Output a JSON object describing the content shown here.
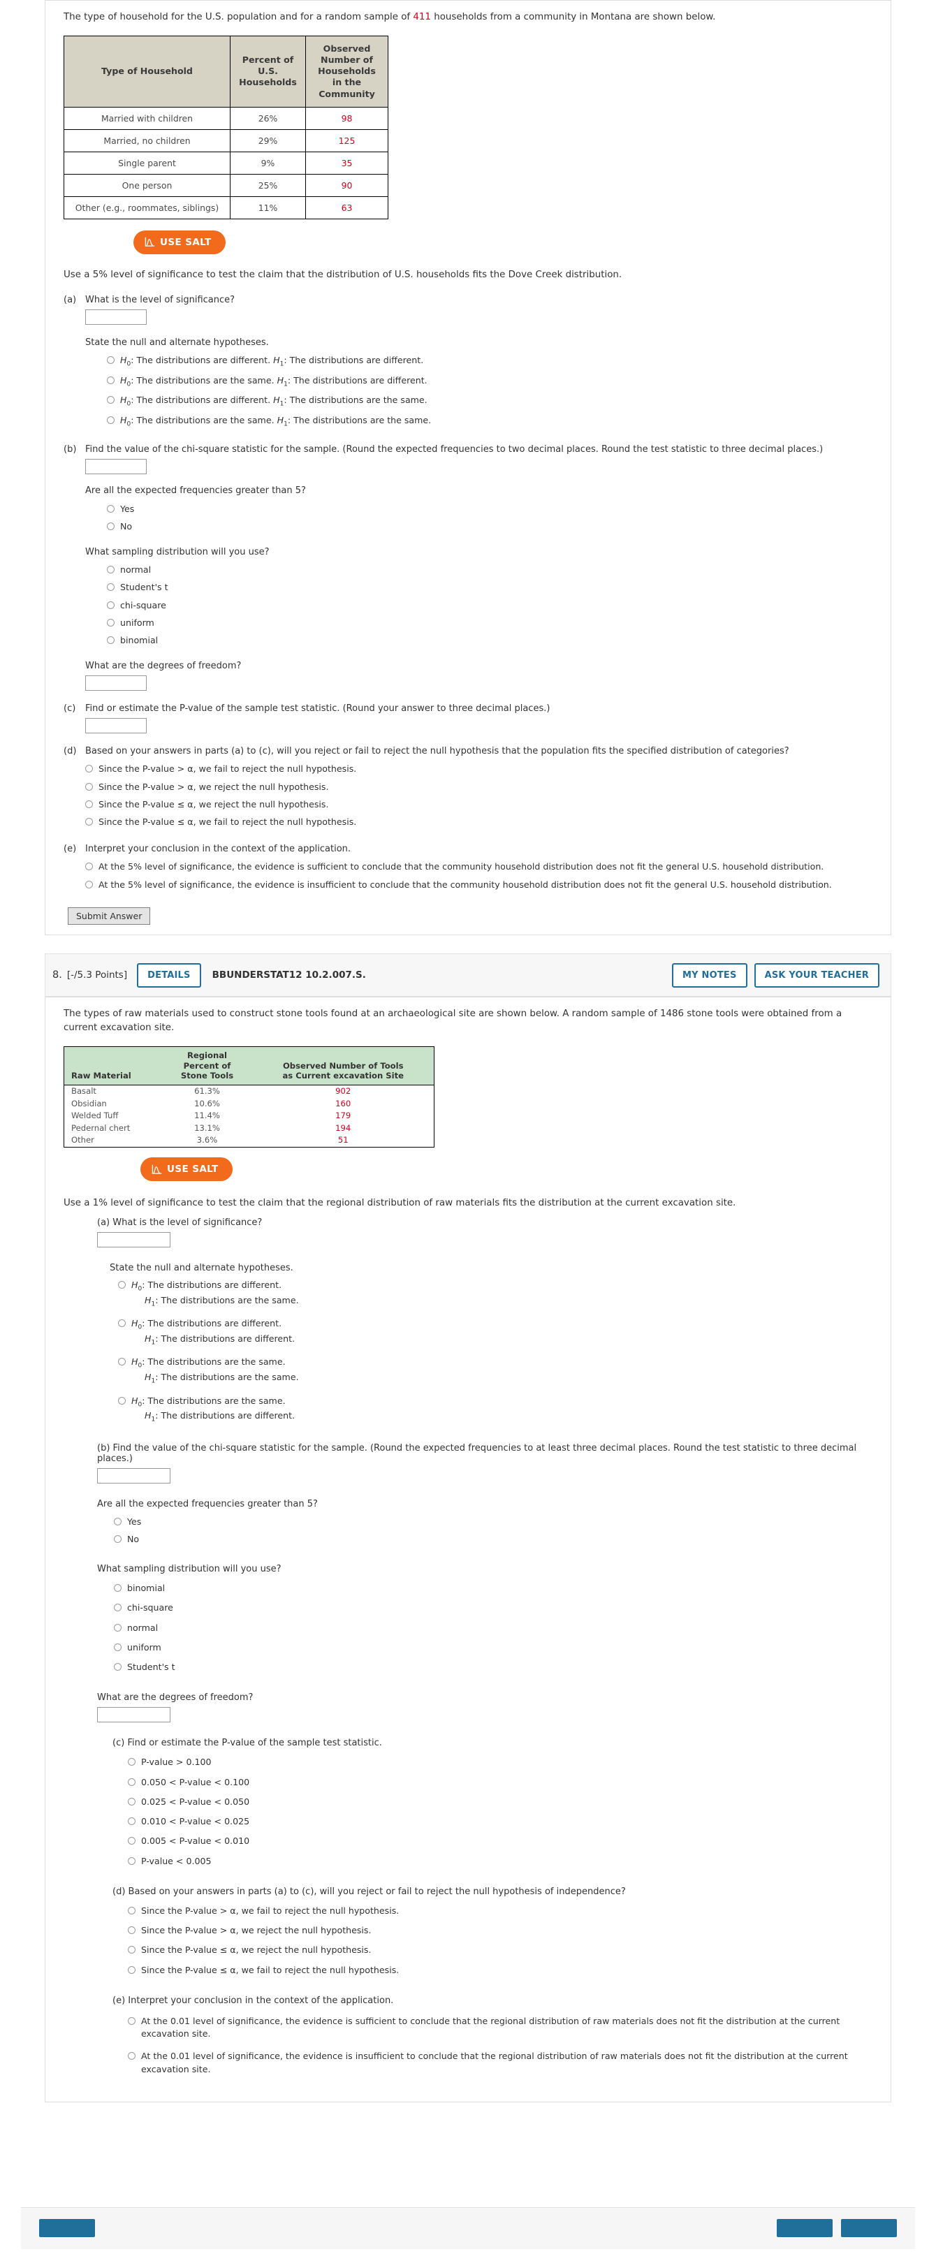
{
  "problem7": {
    "intro_pre": "The type of household for the U.S. population and for a random sample of ",
    "intro_count": "411",
    "intro_post": " households from a community in Montana are shown below.",
    "table": {
      "headers": [
        "Type of Household",
        "Percent of U.S. Households",
        "Observed Number of Households in the Community"
      ],
      "rows": [
        {
          "type": "Married with children",
          "percent": "26%",
          "observed": "98"
        },
        {
          "type": "Married, no children",
          "percent": "29%",
          "observed": "125"
        },
        {
          "type": "Single parent",
          "percent": "9%",
          "observed": "35"
        },
        {
          "type": "One person",
          "percent": "25%",
          "observed": "90"
        },
        {
          "type": "Other (e.g., roommates, siblings)",
          "percent": "11%",
          "observed": "63"
        }
      ]
    },
    "salt_label": "USE SALT",
    "claim": "Use a 5% level of significance to test the claim that the distribution of U.S. households fits the Dove Creek distribution.",
    "parts": {
      "a": {
        "letter": "(a)",
        "question": "What is the level of significance?",
        "input_value": "",
        "hypotheses_prompt": "State the null and alternate hypotheses.",
        "options": [
          "H0: The distributions are different. H1: The distributions are different.",
          "H0: The distributions are the same. H1: The distributions are different.",
          "H0: The distributions are different. H1: The distributions are the same.",
          "H0: The distributions are the same. H1: The distributions are the same."
        ],
        "options_parsed": [
          {
            "h0": "The distributions are different.",
            "h1": "The distributions are different."
          },
          {
            "h0": "The distributions are the same.",
            "h1": "The distributions are different."
          },
          {
            "h0": "The distributions are different.",
            "h1": "The distributions are the same."
          },
          {
            "h0": "The distributions are the same.",
            "h1": "The distributions are the same."
          }
        ]
      },
      "b": {
        "letter": "(b)",
        "question": "Find the value of the chi-square statistic for the sample. (Round the expected frequencies to two decimal places. Round the test statistic to three decimal places.)",
        "input_value": "",
        "expected_prompt": "Are all the expected frequencies greater than 5?",
        "yes_no": [
          "Yes",
          "No"
        ],
        "sampling_prompt": "What sampling distribution will you use?",
        "sampling_options": [
          "normal",
          "Student's t",
          "chi-square",
          "uniform",
          "binomial"
        ],
        "df_prompt": "What are the degrees of freedom?",
        "df_value": ""
      },
      "c": {
        "letter": "(c)",
        "question": "Find or estimate the P-value of the sample test statistic. (Round your answer to three decimal places.)",
        "input_value": ""
      },
      "d": {
        "letter": "(d)",
        "question": "Based on your answers in parts (a) to (c), will you reject or fail to reject the null hypothesis that the population fits the specified distribution of categories?",
        "options": [
          "Since the P-value > α, we fail to reject the null hypothesis.",
          "Since the P-value > α, we reject the null hypothesis.",
          "Since the P-value ≤ α, we reject the null hypothesis.",
          "Since the P-value ≤ α, we fail to reject the null hypothesis."
        ]
      },
      "e": {
        "letter": "(e)",
        "question": "Interpret your conclusion in the context of the application.",
        "options": [
          "At the 5% level of significance, the evidence is sufficient to conclude that the community household distribution does not fit the general U.S. household distribution.",
          "At the 5% level of significance, the evidence is insufficient to conclude that the community household distribution does not fit the general U.S. household distribution."
        ]
      }
    },
    "submit_label": "Submit Answer"
  },
  "problem8": {
    "header": {
      "number": "8.",
      "points": "[-/5.3 Points]",
      "details_label": "DETAILS",
      "code": "BBUNDERSTAT12 10.2.007.S.",
      "my_notes_label": "MY NOTES",
      "ask_teacher_label": "ASK YOUR TEACHER"
    },
    "intro": "The types of raw materials used to construct stone tools found at an archaeological site are shown below. A random sample of 1486 stone tools were obtained from a current excavation site.",
    "table": {
      "headers": [
        "Raw Material",
        "Regional Percent of Stone Tools",
        "Observed Number of Tools as Current excavation Site"
      ],
      "rows": [
        {
          "material": "Basalt",
          "percent": "61.3%",
          "observed": "902"
        },
        {
          "material": "Obsidian",
          "percent": "10.6%",
          "observed": "160"
        },
        {
          "material": "Welded Tuff",
          "percent": "11.4%",
          "observed": "179"
        },
        {
          "material": "Pedernal chert",
          "percent": "13.1%",
          "observed": "194"
        },
        {
          "material": "Other",
          "percent": "3.6%",
          "observed": "51"
        }
      ]
    },
    "salt_label": "USE SALT",
    "claim": "Use a 1% level of significance to test the claim that the regional distribution of raw materials fits the distribution at the current excavation site.",
    "parts": {
      "a": {
        "letter": "(a)",
        "question": "What is the level of significance?",
        "input_value": "",
        "hypotheses_prompt": "State the null and alternate hypotheses.",
        "options_parsed": [
          {
            "h0": "The distributions are different.",
            "h1": "The distributions are the same."
          },
          {
            "h0": "The distributions are different.",
            "h1": "The distributions are different."
          },
          {
            "h0": "The distributions are the same.",
            "h1": "The distributions are the same."
          },
          {
            "h0": "The distributions are the same.",
            "h1": "The distributions are different."
          }
        ]
      },
      "b": {
        "letter": "(b)",
        "question": "Find the value of the chi-square statistic for the sample. (Round the expected frequencies to at least three decimal places. Round the test statistic to three decimal places.)",
        "input_value": "",
        "expected_prompt": "Are all the expected frequencies greater than 5?",
        "yes_no": [
          "Yes",
          "No"
        ],
        "sampling_prompt": "What sampling distribution will you use?",
        "sampling_options": [
          "binomial",
          "chi-square",
          "normal",
          "uniform",
          "Student's t"
        ],
        "df_prompt": "What are the degrees of freedom?",
        "df_value": ""
      },
      "c": {
        "letter": "(c)",
        "question": "Find or estimate the P-value of the sample test statistic.",
        "options": [
          "P-value > 0.100",
          "0.050 < P-value < 0.100",
          "0.025 < P-value < 0.050",
          "0.010 < P-value < 0.025",
          "0.005 < P-value < 0.010",
          "P-value < 0.005"
        ]
      },
      "d": {
        "letter": "(d)",
        "question": "Based on your answers in parts (a) to (c), will you reject or fail to reject the null hypothesis of independence?",
        "options": [
          "Since the P-value > α, we fail to reject the null hypothesis.",
          "Since the P-value > α, we reject the null hypothesis.",
          "Since the P-value ≤ α, we reject the null hypothesis.",
          "Since the P-value ≤ α, we fail to reject the null hypothesis."
        ]
      },
      "e": {
        "letter": "(e)",
        "question": "Interpret your conclusion in the context of the application.",
        "options": [
          "At the 0.01 level of significance, the evidence is sufficient to conclude that the regional distribution of raw materials does not fit the distribution at the current excavation site.",
          "At the 0.01 level of significance, the evidence is insufficient to conclude that the regional distribution of raw materials does not fit the distribution at the current excavation site."
        ]
      }
    }
  },
  "colors": {
    "accent_orange": "#f26a1b",
    "accent_blue": "#1f6f9a",
    "data_red": "#d0021b",
    "table7_header": "#d6d2c4",
    "table8_header": "#c9e3cb"
  }
}
